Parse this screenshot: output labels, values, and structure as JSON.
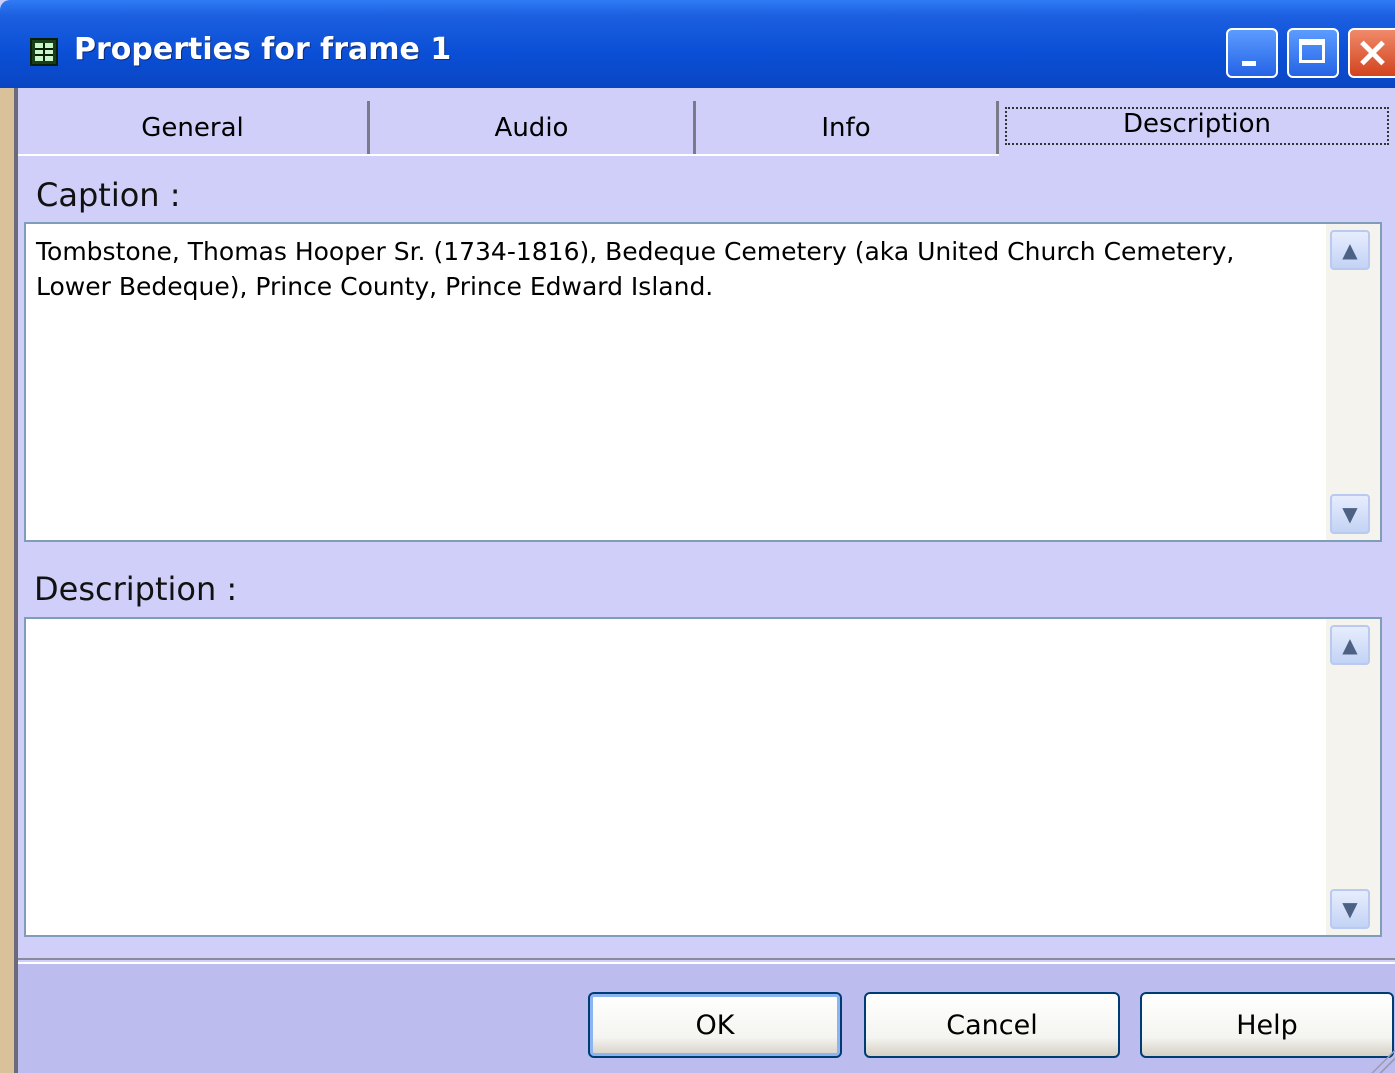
{
  "window": {
    "title": "Properties for frame 1",
    "title_icon": "table-grid-icon",
    "controls": {
      "minimize": "minimize-icon",
      "maximize": "maximize-icon",
      "close": "close-icon"
    }
  },
  "tabs": [
    {
      "label": "General",
      "active": false
    },
    {
      "label": "Audio",
      "active": false
    },
    {
      "label": "Info",
      "active": false
    },
    {
      "label": "Description",
      "active": true
    }
  ],
  "caption": {
    "label": "Caption :",
    "value": "Tombstone, Thomas Hooper Sr. (1734-1816), Bedeque Cemetery (aka United Church Cemetery,\nLower Bedeque), Prince County, Prince Edward Island."
  },
  "description": {
    "label": "Description :",
    "value": ""
  },
  "buttons": {
    "ok": "OK",
    "cancel": "Cancel",
    "help": "Help"
  },
  "colors": {
    "titlebar": "#0a4fd6",
    "dialog_bg": "#cfcff9",
    "field_border": "#7f9db9",
    "close_button": "#d2431f"
  }
}
